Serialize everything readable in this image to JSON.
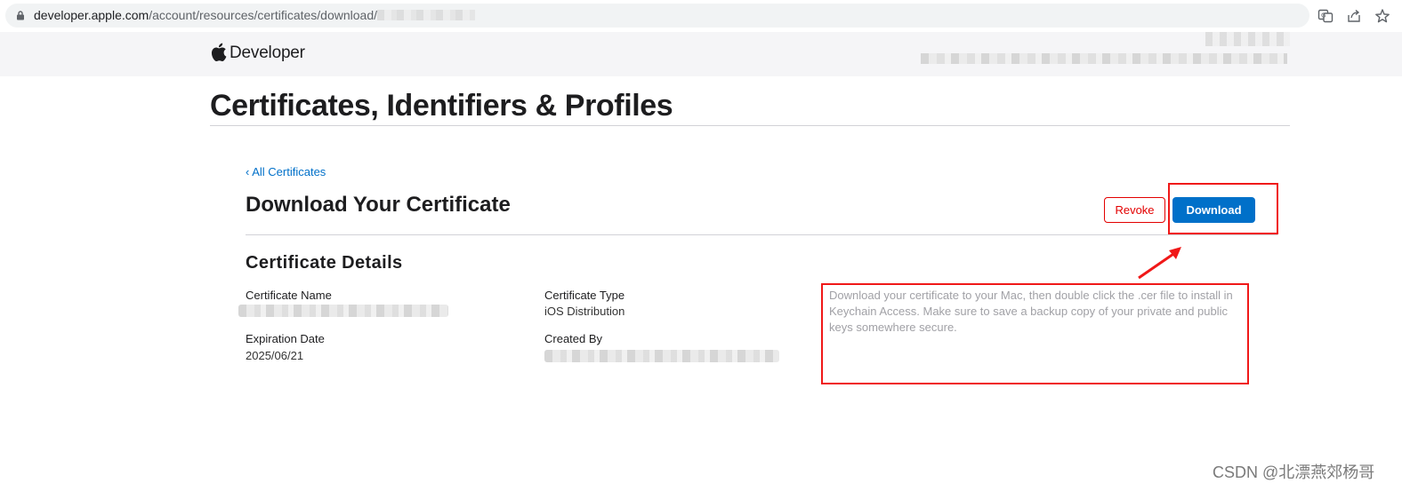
{
  "browser": {
    "url_host": "developer.apple.com",
    "url_path": "/account/resources/certificates/download/",
    "icons": [
      "lock-icon",
      "translate-icon",
      "share-icon",
      "bookmark-star-icon"
    ]
  },
  "header": {
    "brand": "Developer",
    "logo_icon": "apple-logo-icon"
  },
  "page": {
    "title": "Certificates, Identifiers & Profiles"
  },
  "certificate": {
    "back_link": "‹ All Certificates",
    "heading": "Download Your Certificate",
    "revoke_label": "Revoke",
    "download_label": "Download",
    "details_heading": "Certificate Details",
    "name_label": "Certificate Name",
    "type_label": "Certificate Type",
    "type_value": "iOS Distribution",
    "expiration_label": "Expiration Date",
    "expiration_value": "2025/06/21",
    "created_by_label": "Created By",
    "info_text": "Download your certificate to your Mac, then double click the .cer file to install in Keychain Access. Make sure to save a backup copy of your private and public keys somewhere secure."
  },
  "colors": {
    "accent_blue": "#0070c9",
    "revoke_red": "#e30000",
    "annotation_red": "#f01818"
  },
  "watermark": "CSDN @北漂燕郊杨哥"
}
